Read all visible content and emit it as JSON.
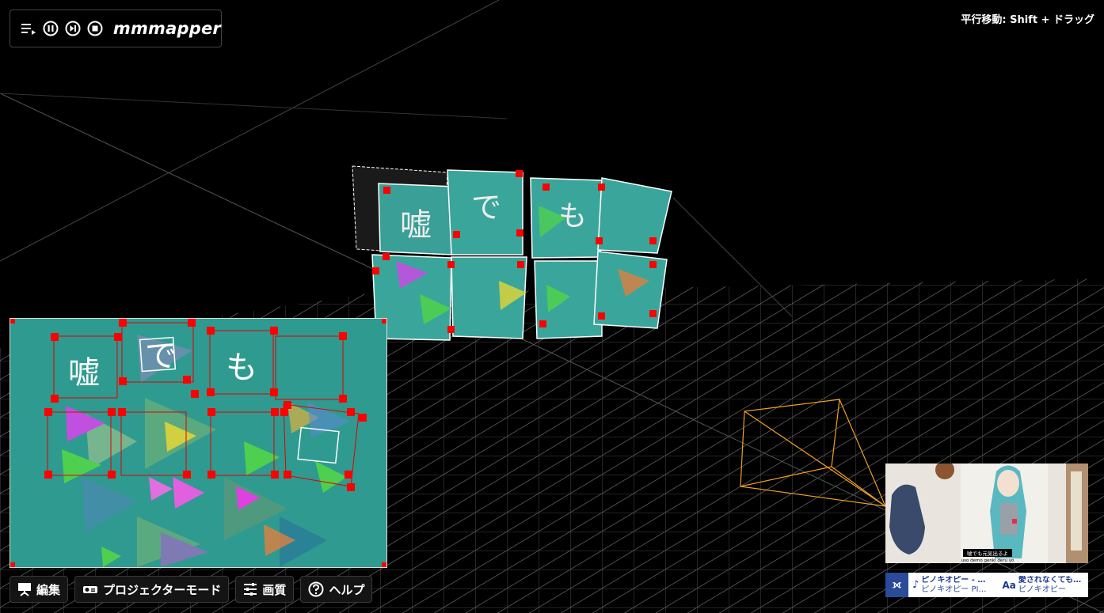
{
  "app": {
    "title": "mmmapper",
    "hint": "平行移動: Shift + ドラッグ"
  },
  "toolbar": {
    "icons": [
      "playlist-icon",
      "pause-icon",
      "skip-next-icon",
      "stop-icon"
    ]
  },
  "lyrics": {
    "char1": "嘘",
    "char2": "で",
    "char3": "も"
  },
  "bottom_bar": {
    "edit_label": "編集",
    "projector_label": "プロジェクターモード",
    "quality_label": "画質",
    "help_label": "ヘルプ"
  },
  "video": {
    "subtitle": "嘘でも元気出るよ",
    "romaji": "uso demo genki deru yo"
  },
  "song_bar": {
    "logo": "♪",
    "song_title": "ピノキオピー - 愛さ…",
    "song_artist": "ピノキオピー PINO…",
    "song2_title": "愛されなくても君が…",
    "song2_artist": "ピノキオピー"
  },
  "colors": {
    "editor_bg": "#2f9a8f",
    "handle": "#ff0000",
    "camera_frustum": "#f0a020"
  }
}
